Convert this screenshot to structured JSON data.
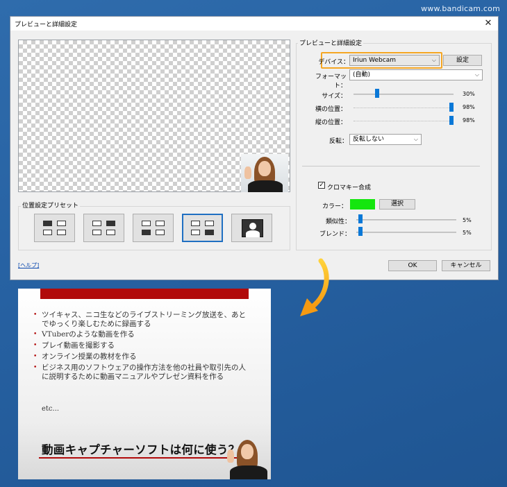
{
  "watermark": "www.bandicam.com",
  "dialog": {
    "title": "プレビューと詳細設定",
    "close_glyph": "✕",
    "preset_group_label": "位置設定プリセット",
    "settings_group_label": "プレビューと詳細設定",
    "device_label": "デバイス：",
    "device_value": "Iriun Webcam",
    "device_settings_button": "設定",
    "format_label": "フォーマット：",
    "format_value": "(自動)",
    "size_label": "サイズ：",
    "size_value": "30%",
    "hpos_label": "横の位置：",
    "hpos_value": "98%",
    "vpos_label": "縦の位置：",
    "vpos_value": "98%",
    "flip_label": "反転：",
    "flip_value": "反転しない",
    "chroma_label": "クロマキー合成",
    "chroma_checked": true,
    "color_label": "カラー：",
    "color_swatch": "#14e60e",
    "select_button": "選択",
    "similarity_label": "類似性：",
    "similarity_value": "5%",
    "blend_label": "ブレンド：",
    "blend_value": "5%",
    "help_link": "[ヘルプ]",
    "ok_button": "OK",
    "cancel_button": "キャンセル",
    "highlight_color": "#f5a623"
  },
  "slide": {
    "bullets": [
      "ツイキャス、ニコ生などのライブストリーミング放送を、あとでゆっくり楽しむために録画する",
      "VTuberのような動画を作る",
      "プレイ動画を撮影する",
      "オンライン授業の教材を作る",
      "ビジネス用のソフトウェアの操作方法を他の社員や取引先の人に説明するために動画マニュアルやプレゼン資料を作る"
    ],
    "etc": "etc...",
    "heading": "動画キャプチャーソフトは何に使う？"
  }
}
